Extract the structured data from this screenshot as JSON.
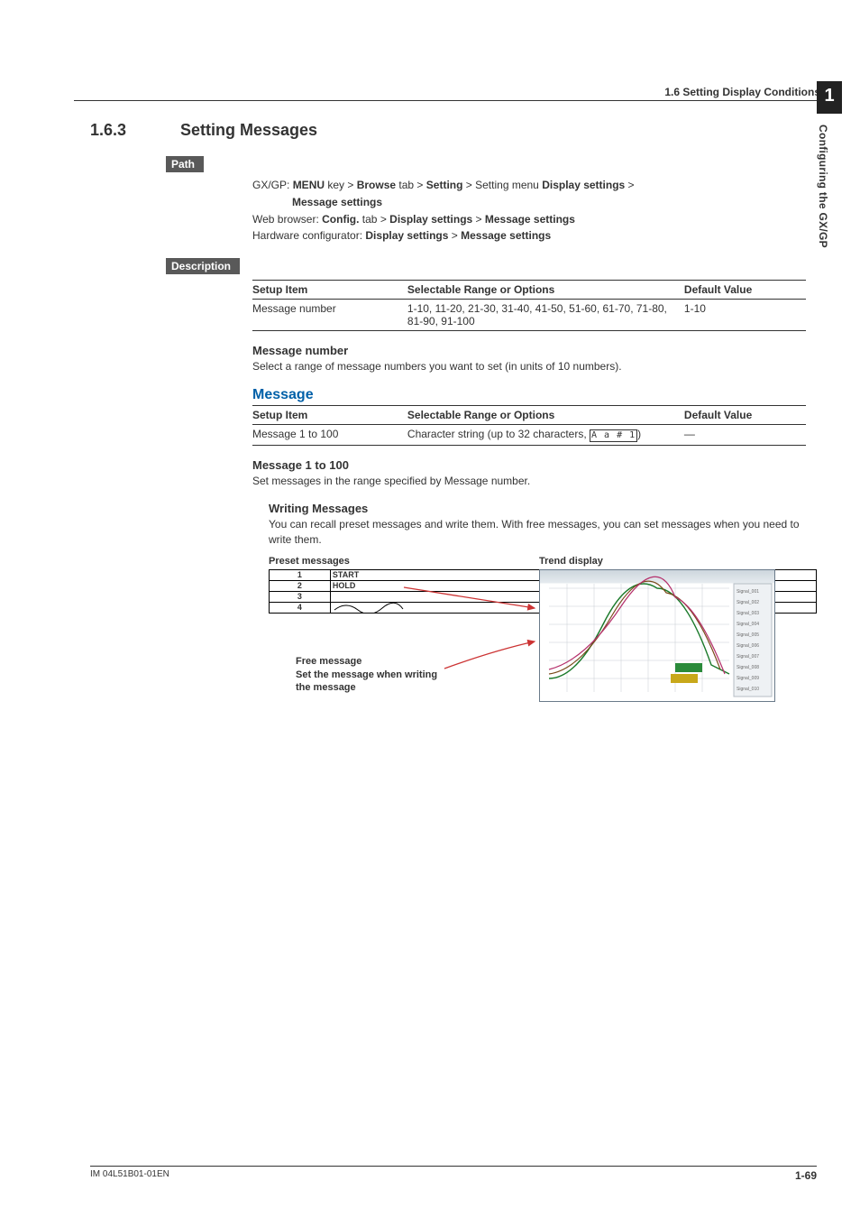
{
  "header": {
    "breadcrumb": "1.6  Setting Display Conditions"
  },
  "section": {
    "number": "1.6.3",
    "title": "Setting Messages"
  },
  "badges": {
    "path": "Path",
    "description": "Description"
  },
  "path": {
    "line1_prefix": "GX/GP: ",
    "line1_b1": "MENU",
    "line1_t1": " key > ",
    "line1_b2": "Browse",
    "line1_t2": " tab > ",
    "line1_b3": "Setting",
    "line1_t3": " > Setting menu ",
    "line1_b4": "Display settings",
    "line1_t4": " >",
    "line1_cont": "Message settings",
    "line2_prefix": "Web browser: ",
    "line2_b1": "Config.",
    "line2_t1": " tab > ",
    "line2_b2": "Display settings",
    "line2_t2": " > ",
    "line2_b3": "Message settings",
    "line3_prefix": "Hardware configurator: ",
    "line3_b1": "Display settings",
    "line3_t1": " > ",
    "line3_b2": "Message settings"
  },
  "table1": {
    "h1": "Setup Item",
    "h2": "Selectable Range or Options",
    "h3": "Default Value",
    "r1c1": "Message number",
    "r1c2": "1-10, 11-20, 21-30, 31-40, 41-50, 51-60, 61-70, 71-80, 81-90, 91-100",
    "r1c3": "1-10"
  },
  "msgnum": {
    "head": "Message number",
    "body": "Select a range of message numbers you want to set (in units of 10 numbers)."
  },
  "message_head": "Message",
  "table2": {
    "h1": "Setup Item",
    "h2": "Selectable Range or Options",
    "h3": "Default Value",
    "r1c1": "Message 1 to 100",
    "r1c2a": "Character string (up to 32 characters, ",
    "r1c2b": "A a # 1",
    "r1c2c": ")",
    "r1c3": "―"
  },
  "msg1to100": {
    "head": "Message 1 to 100",
    "body": "Set messages in the range specified by Message number."
  },
  "writing": {
    "head": "Writing Messages",
    "body": "You can recall preset messages and write them. With free messages, you can set messages when you need to write them."
  },
  "illus": {
    "preset_label": "Preset messages",
    "trend_label": "Trend display",
    "rows": {
      "n1": "1",
      "t1": "START",
      "n2": "2",
      "t2": "HOLD",
      "n3": "3",
      "t3": "",
      "n4": "4",
      "t4": ""
    },
    "free_l1": "Free message",
    "free_l2": "Set the message when writing",
    "free_l3": "the message"
  },
  "sidetab": {
    "num": "1",
    "text": "Configuring the GX/GP"
  },
  "footer": {
    "doc": "IM 04L51B01-01EN",
    "page": "1-69"
  }
}
